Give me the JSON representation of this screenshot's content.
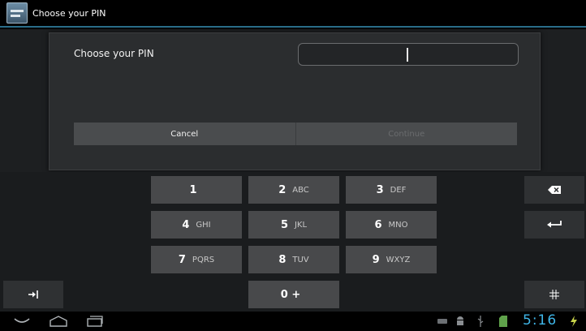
{
  "window": {
    "title": "Choose your PIN"
  },
  "dialog": {
    "label": "Choose your PIN",
    "input_value": "",
    "cancel_label": "Cancel",
    "continue_label": "Continue"
  },
  "keyboard": {
    "keys": [
      {
        "num": "1",
        "letters": ""
      },
      {
        "num": "2",
        "letters": "ABC"
      },
      {
        "num": "3",
        "letters": "DEF"
      },
      {
        "num": "4",
        "letters": "GHI"
      },
      {
        "num": "5",
        "letters": "JKL"
      },
      {
        "num": "6",
        "letters": "MNO"
      },
      {
        "num": "7",
        "letters": "PQRS"
      },
      {
        "num": "8",
        "letters": "TUV"
      },
      {
        "num": "9",
        "letters": "WXYZ"
      },
      {
        "num": "0 +",
        "letters": ""
      }
    ],
    "icons": {
      "backspace": "backspace-icon",
      "enter": "enter-icon",
      "tab": "tab-icon",
      "symbols": "symbols-icon"
    }
  },
  "statusbar": {
    "clock": "5:16",
    "icons": [
      "back-icon",
      "home-icon",
      "recent-apps-icon",
      "keyboard-icon",
      "android-icon",
      "usb-icon",
      "sd-card-icon",
      "battery-charging-icon"
    ]
  },
  "colors": {
    "accent": "#3fb6e8",
    "key": "#48494b",
    "dialog": "#2b2d2f"
  }
}
